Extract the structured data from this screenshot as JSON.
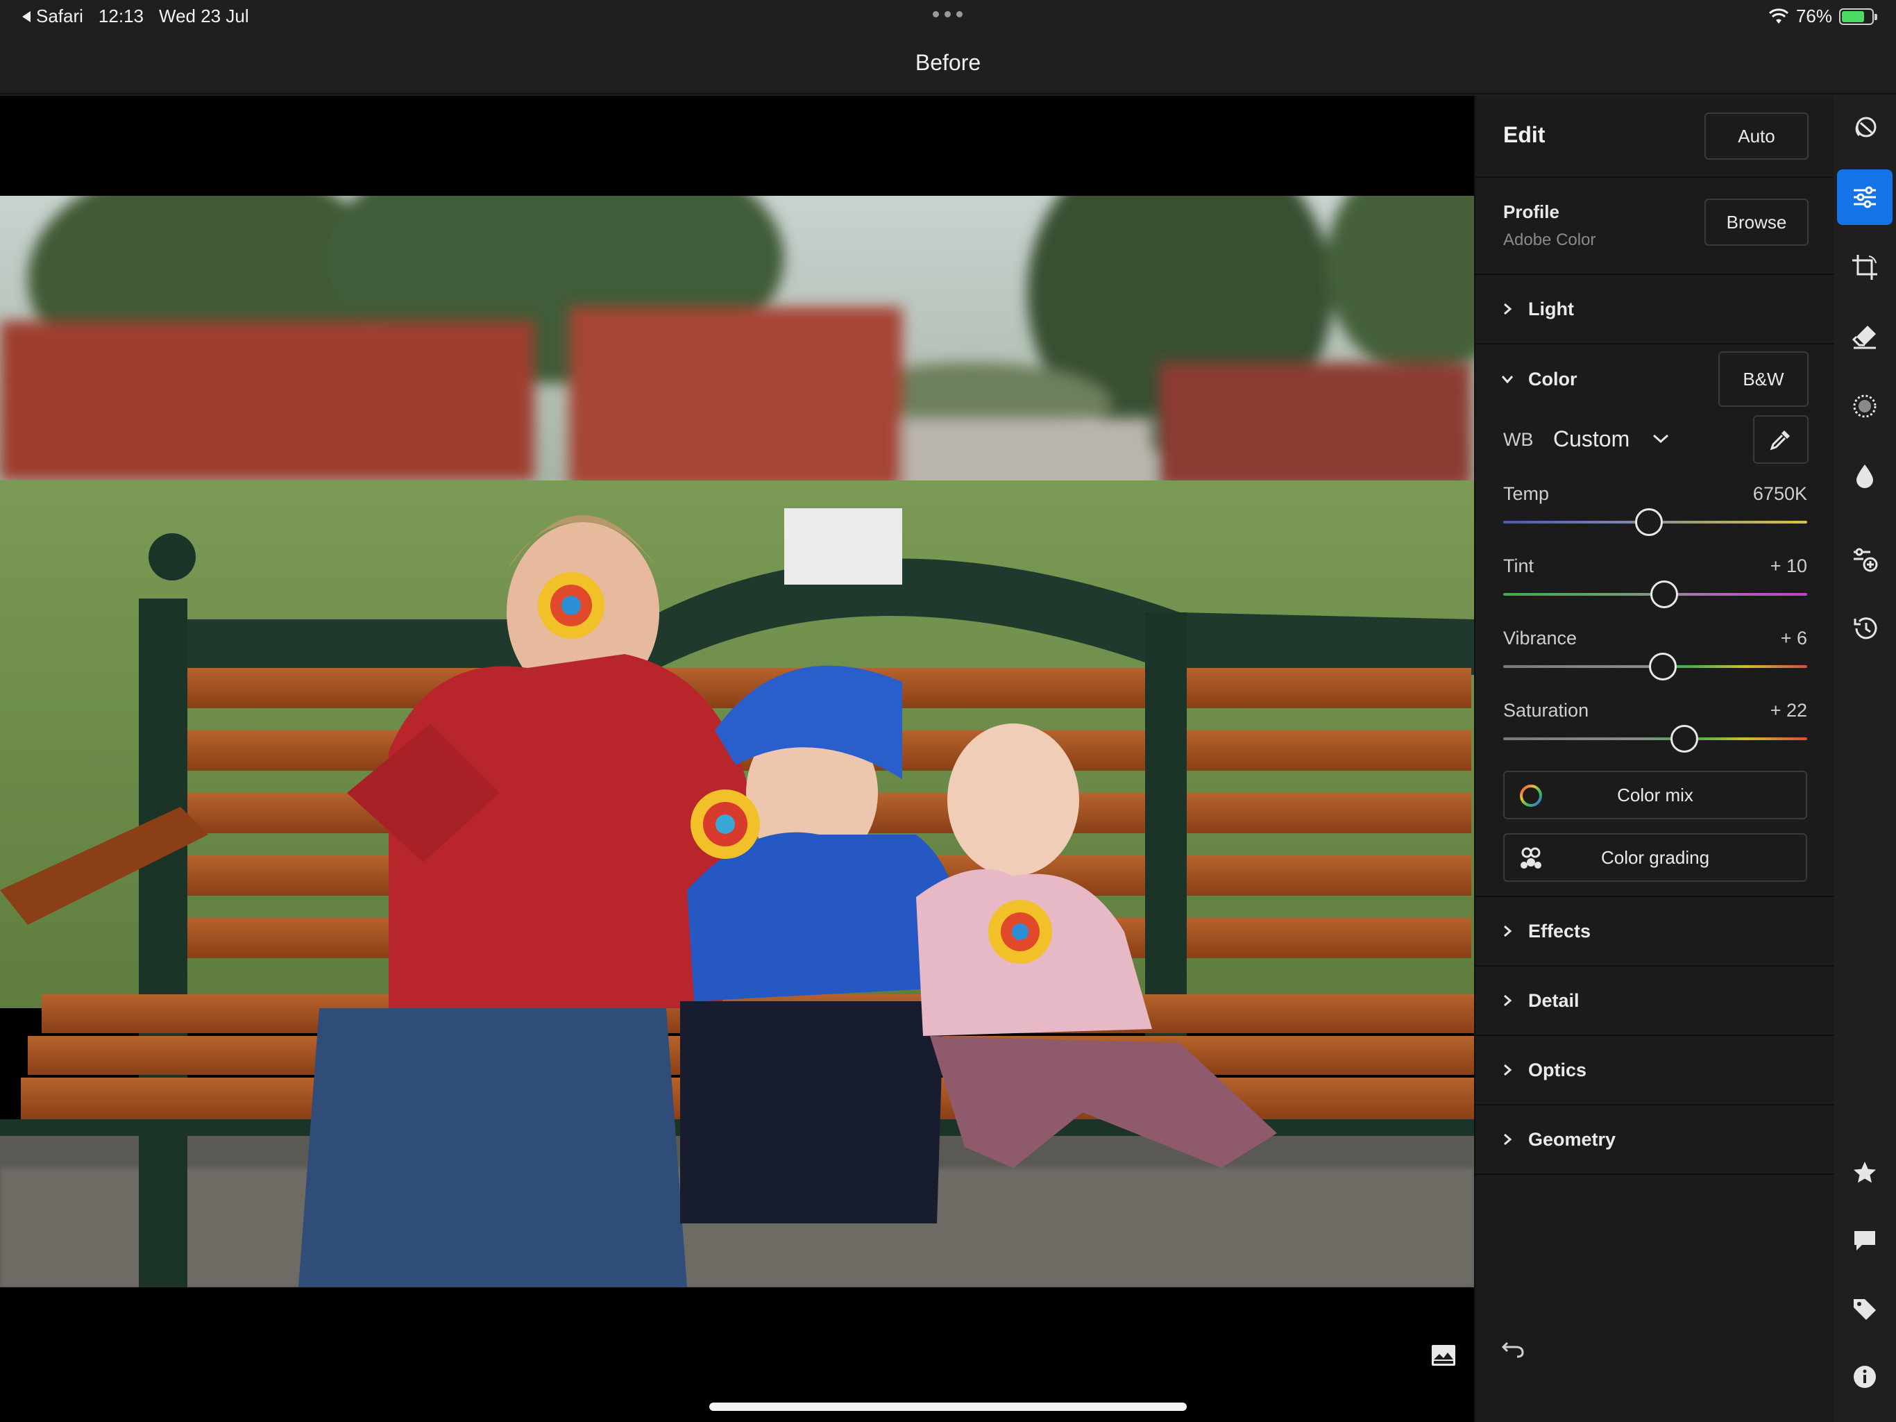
{
  "status": {
    "back_app": "Safari",
    "time": "12:13",
    "date": "Wed 23 Jul",
    "battery": "76%",
    "battery_level": 0.76
  },
  "titlebar": {
    "title": "Before"
  },
  "panel": {
    "title": "Edit",
    "auto_label": "Auto",
    "profile": {
      "label": "Profile",
      "value": "Adobe Color",
      "browse_label": "Browse"
    },
    "sections": {
      "light": "Light",
      "color": "Color",
      "effects": "Effects",
      "detail": "Detail",
      "optics": "Optics",
      "geometry": "Geometry"
    },
    "color": {
      "bw_label": "B&W",
      "wb_label": "WB",
      "wb_preset": "Custom",
      "sliders": [
        {
          "name": "Temp",
          "value": "6750K",
          "level": 0.48
        },
        {
          "name": "Tint",
          "value": "+ 10",
          "level": 0.53
        },
        {
          "name": "Vibrance",
          "value": "+ 6",
          "level": 0.525
        },
        {
          "name": "Saturation",
          "value": "+ 22",
          "level": 0.595
        }
      ],
      "color_mix_label": "Color mix",
      "color_grading_label": "Color grading"
    }
  },
  "rail": {
    "tools": [
      "presets-icon",
      "edit-sliders-icon",
      "crop-icon",
      "healing-eraser-icon",
      "masking-icon",
      "blur-drop-icon",
      "versions-icon",
      "history-icon"
    ],
    "bottom": [
      "star-rating-icon",
      "comment-icon",
      "tag-icon",
      "info-icon"
    ],
    "active": "edit-sliders-icon",
    "accent": "#1473e6"
  }
}
